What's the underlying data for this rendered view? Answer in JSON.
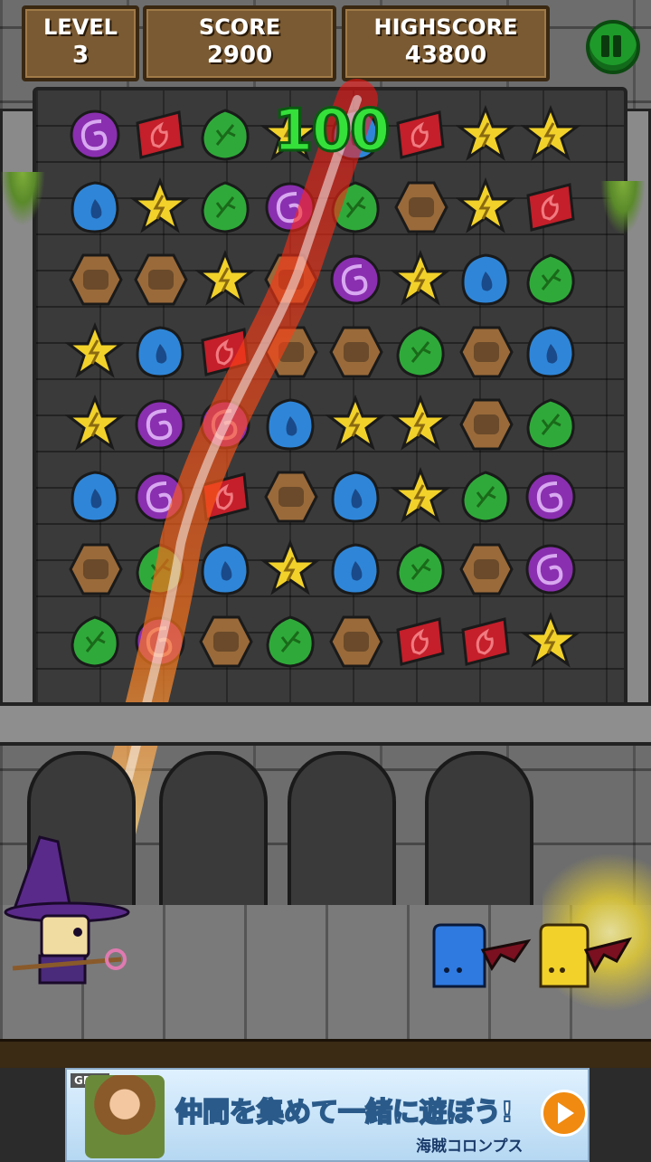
{
  "hud": {
    "level_label": "LEVEL",
    "level_value": "3",
    "score_label": "SCORE",
    "score_value": "2900",
    "highscore_label": "HIGHSCORE",
    "highscore_value": "43800",
    "pause_icon": "pause-icon"
  },
  "popup": {
    "points": "100"
  },
  "board": {
    "gem_types": {
      "P": {
        "name": "purple-swirl",
        "color": "#8a2fb0"
      },
      "R": {
        "name": "red-flame",
        "color": "#c41f2a"
      },
      "G": {
        "name": "green-leaf",
        "color": "#2faa3a"
      },
      "B": {
        "name": "blue-drop",
        "color": "#2f86d8"
      },
      "Y": {
        "name": "yellow-star",
        "color": "#f2d22a"
      },
      "H": {
        "name": "brown-rock",
        "color": "#9a6a3a"
      }
    },
    "rows": [
      [
        "P",
        "R",
        "G",
        "Y",
        "B",
        "R",
        "Y",
        "Y"
      ],
      [
        "B",
        "Y",
        "G",
        "P",
        "G",
        "H",
        "Y",
        "R"
      ],
      [
        "H",
        "H",
        "Y",
        "H",
        "P",
        "Y",
        "B",
        "G"
      ],
      [
        "Y",
        "B",
        "R",
        "H",
        "H",
        "G",
        "H",
        "B"
      ],
      [
        "Y",
        "P",
        "P",
        "B",
        "Y",
        "Y",
        "H",
        "G"
      ],
      [
        "B",
        "P",
        "R",
        "H",
        "B",
        "Y",
        "G",
        "P"
      ],
      [
        "H",
        "G",
        "B",
        "Y",
        "B",
        "G",
        "H",
        "P"
      ],
      [
        "G",
        "P",
        "H",
        "G",
        "H",
        "R",
        "R",
        "Y"
      ]
    ]
  },
  "characters": {
    "hero": "wizard",
    "enemies": [
      "blue-slime-bat",
      "yellow-slime-bat"
    ]
  },
  "ad": {
    "brand": "GREE",
    "headline": "仲間を集めて一緒に遊ぼう!",
    "subtitle": "海賊コロンプス",
    "play_icon": "play-icon"
  }
}
